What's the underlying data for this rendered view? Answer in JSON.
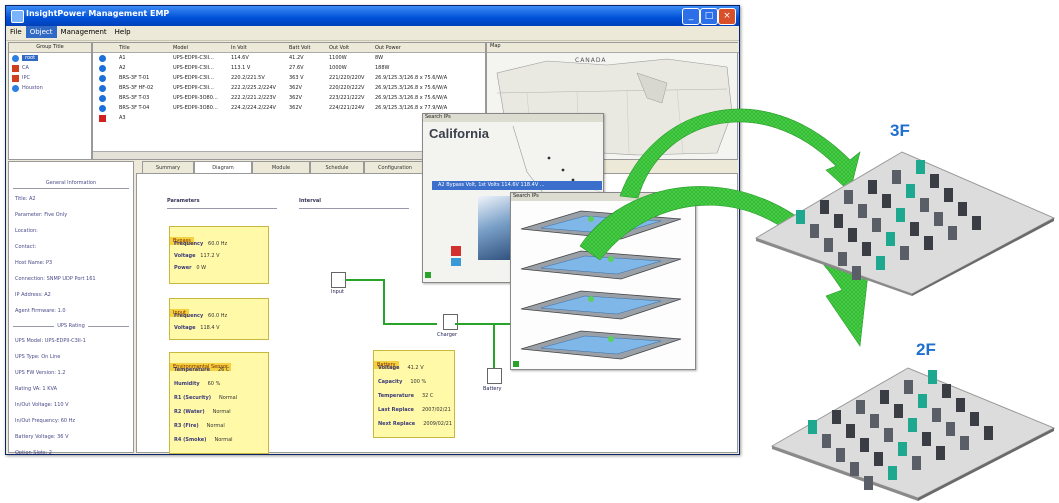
{
  "window": {
    "title": "InsightPower Management EMP",
    "controls": [
      "_",
      "□",
      "×"
    ]
  },
  "menu": [
    "File",
    "Object",
    "Management",
    "Help"
  ],
  "group_title": "Group Title",
  "groups": [
    "root",
    "CA",
    "IPC",
    "Houston"
  ],
  "device_table": {
    "columns": [
      "Title",
      "Model",
      "In Volt",
      "Batt Volt",
      "Out Volt",
      "Out Power"
    ],
    "rows": [
      [
        "A1",
        "UPS-EDPII-C3II...",
        "114.6V",
        "41.2V",
        "1100W",
        "8W"
      ],
      [
        "A2",
        "UPS-EDPII-C3II...",
        "113.1 V",
        "27.6V",
        "1000W",
        "188W"
      ],
      [
        "BRS-3F T-01",
        "UPS-EDPII-C3II...",
        "220.2/221.5V",
        "363 V",
        "221/220/220V",
        "26.9/125.3/126.8 x 75.6/W/A"
      ],
      [
        "BRS-3F HF-02",
        "UPS-EDPII-C3II...",
        "222.2/225.2/224V",
        "362V",
        "220/220/222V",
        "26.9/125.3/126.8 x 75.6/W/A"
      ],
      [
        "BRS-3F T-03",
        "UPS-EDPII-3O80...",
        "222.2/221.2/223V",
        "362V",
        "223/221/222V",
        "26.9/125.3/126.8 x 75.6/W/A"
      ],
      [
        "BRS-3F T-04",
        "UPS-EDPII-3O80...",
        "224.2/224.2/224V",
        "362V",
        "224/221/224V",
        "26.9/125.3/126.8 x 77.9/W/A"
      ],
      [
        "A3",
        "",
        "",
        "",
        "",
        ""
      ]
    ],
    "status_colors": [
      "#1a6fd8",
      "#1a6fd8",
      "#1a6fd8",
      "#1a6fd8",
      "#1a6fd8",
      "#1a6fd8",
      "#d02020"
    ]
  },
  "map_label": "Map",
  "map_city": "CANADA",
  "info": {
    "heading": "General Information",
    "items": [
      "Title: A2",
      "Parameter: Five Only",
      "Location:",
      "Contact:",
      "Host Name: P3",
      "Connection: SNMP UDP Port 161",
      "IP Address: A2",
      "Agent Firmware: 1.0"
    ],
    "ups_heading": "UPS Rating",
    "ups_items": [
      "UPS Model: UPS-EDPII-C3II-1",
      "UPS Type: On Line",
      "UPS FW Version: 1.2",
      "Rating VA: 1 KVA",
      "In/Out Voltage: 110 V",
      "In/Out Frequency: 60 Hz",
      "Battery Voltage: 36 V",
      "Option Slots: 2"
    ]
  },
  "tabs": [
    "Summary",
    "Diagram",
    "Module",
    "Schedule",
    "Configuration"
  ],
  "active_tab": "Diagram",
  "diagram": {
    "parameters_label": "Parameters",
    "interval_label": "Interval",
    "bypass": {
      "title": "Bypass",
      "rows": [
        [
          "Frequency",
          "60.0 Hz"
        ],
        [
          "Voltage",
          "117.2 V"
        ],
        [
          "Power",
          "0 W"
        ]
      ]
    },
    "input": {
      "title": "Input",
      "rows": [
        [
          "Frequency",
          "60.0 Hz"
        ],
        [
          "Voltage",
          "118.4 V"
        ]
      ]
    },
    "env": {
      "title": "Environmental Sensor",
      "rows": [
        [
          "Temperature",
          "26 C"
        ],
        [
          "Humidity",
          "60 %"
        ],
        [
          "R1 (Security)",
          "Normal"
        ],
        [
          "R2 (Water)",
          "Normal"
        ],
        [
          "R3 (Fire)",
          "Normal"
        ],
        [
          "R4 (Smoke)",
          "Normal"
        ]
      ]
    },
    "battery": {
      "title": "Battery",
      "rows": [
        [
          "Voltage",
          "41.2 V"
        ],
        [
          "Capacity",
          "100 %"
        ],
        [
          "Temperature",
          "32 C"
        ],
        [
          "Last Replace",
          "2007/02/21"
        ],
        [
          "Next Replace",
          "2009/02/21"
        ]
      ]
    },
    "nodes": {
      "input": "Input",
      "charger": "Charger",
      "battery": "Battery"
    }
  },
  "map_popup": {
    "title": "Search IPs",
    "state": "California"
  },
  "floor_popup": {
    "title": "Search IPs",
    "bar": "A2  Bypass Volt, 1st Volts 114.6V 118.4V ..."
  },
  "floors": [
    "3F",
    "2F"
  ],
  "colors": {
    "arrow": "#3cc83c",
    "floor_label": "#1f6fd0",
    "title_blue": "#0050d8"
  }
}
